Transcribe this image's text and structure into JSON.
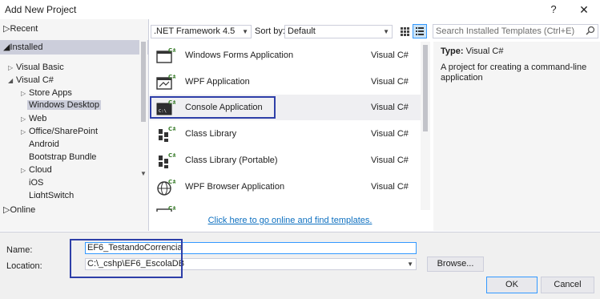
{
  "window": {
    "title": "Add New Project",
    "help_glyph": "?",
    "close_glyph": "✕"
  },
  "tree": {
    "recent": "Recent",
    "installed": "Installed",
    "items": [
      {
        "label": "Visual Basic",
        "expander": "▷"
      },
      {
        "label": "Visual C#",
        "expander": "◢"
      },
      {
        "label": "Store Apps",
        "expander": "▷"
      },
      {
        "label": "Windows Desktop",
        "expander": ""
      },
      {
        "label": "Web",
        "expander": "▷"
      },
      {
        "label": "Office/SharePoint",
        "expander": "▷"
      },
      {
        "label": "Android",
        "expander": ""
      },
      {
        "label": "Bootstrap Bundle",
        "expander": ""
      },
      {
        "label": "Cloud",
        "expander": "▷"
      },
      {
        "label": "iOS",
        "expander": ""
      },
      {
        "label": "LightSwitch",
        "expander": ""
      }
    ],
    "online": "Online"
  },
  "toolbar": {
    "framework": ".NET Framework 4.5",
    "sort_label": "Sort by:",
    "sort_value": "Default",
    "search_placeholder": "Search Installed Templates (Ctrl+E)"
  },
  "templates": [
    {
      "name": "Windows Forms Application",
      "lang": "Visual C#",
      "icon": "windows-forms-icon"
    },
    {
      "name": "WPF Application",
      "lang": "Visual C#",
      "icon": "wpf-icon"
    },
    {
      "name": "Console Application",
      "lang": "Visual C#",
      "icon": "console-icon"
    },
    {
      "name": "Class Library",
      "lang": "Visual C#",
      "icon": "class-library-icon"
    },
    {
      "name": "Class Library (Portable)",
      "lang": "Visual C#",
      "icon": "portable-library-icon"
    },
    {
      "name": "WPF Browser Application",
      "lang": "Visual C#",
      "icon": "wpf-browser-icon"
    },
    {
      "name": "",
      "lang": "",
      "icon": "partial-template-icon"
    }
  ],
  "online_link": "Click here to go online and find templates.",
  "details": {
    "type_label": "Type:",
    "type_value": "Visual C#",
    "description": "A project for creating a command-line application"
  },
  "form": {
    "name_label": "Name:",
    "name_value": "EF6_TestandoCorrencia",
    "location_label": "Location:",
    "location_value": "C:\\_cshp\\EF6_EscolaDB",
    "browse_label": "Browse...",
    "ok_label": "OK",
    "cancel_label": "Cancel"
  },
  "colors": {
    "selection": "#cccedb",
    "link": "#0e70c0",
    "annotation": "#2e3fa8",
    "focus": "#3399ff"
  }
}
